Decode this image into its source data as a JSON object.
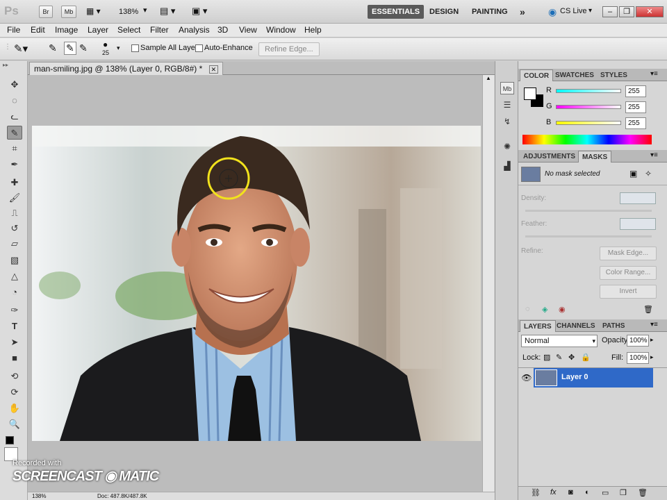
{
  "app": {
    "logo": "Ps",
    "bridge": "Br",
    "minibridge": "Mb",
    "zoom": "138%"
  },
  "workspaces": [
    "ESSENTIALS",
    "DESIGN",
    "PAINTING"
  ],
  "more_workspaces": "»",
  "cs_live": "CS Live",
  "window_controls": {
    "minimize": "–",
    "restore": "❐",
    "close": "✕"
  },
  "menu": [
    "File",
    "Edit",
    "Image",
    "Layer",
    "Select",
    "Filter",
    "Analysis",
    "3D",
    "View",
    "Window",
    "Help"
  ],
  "options": {
    "brush_size": "25",
    "sample_all_layers": "Sample All Layers",
    "auto_enhance": "Auto-Enhance",
    "refine_edge": "Refine Edge..."
  },
  "document": {
    "tab_title": "man-smiling.jpg @ 138% (Layer 0, RGB/8#) *",
    "close": "✕"
  },
  "status": {
    "zoom": "138%",
    "doc": "Doc: 487.8K/487.8K"
  },
  "color_panel": {
    "tabs": [
      "COLOR",
      "SWATCHES",
      "STYLES"
    ],
    "channels": [
      {
        "label": "R",
        "value": "255",
        "color": "#00ffff"
      },
      {
        "label": "G",
        "value": "255",
        "color": "#ff00ff"
      },
      {
        "label": "B",
        "value": "255",
        "color": "#ffff00"
      }
    ]
  },
  "masks_panel": {
    "tabs": [
      "ADJUSTMENTS",
      "MASKS"
    ],
    "no_mask": "No mask selected",
    "density": "Density:",
    "feather": "Feather:",
    "refine": "Refine:",
    "buttons": [
      "Mask Edge...",
      "Color Range...",
      "Invert"
    ]
  },
  "layers_panel": {
    "tabs": [
      "LAYERS",
      "CHANNELS",
      "PATHS"
    ],
    "blend_mode": "Normal",
    "opacity_label": "Opacity:",
    "opacity": "100%",
    "lock_label": "Lock:",
    "fill_label": "Fill:",
    "fill": "100%",
    "layers": [
      {
        "name": "Layer 0"
      }
    ]
  },
  "watermark": {
    "line1": "Recorded with",
    "line2": "SCREENCAST",
    "line3": "MATIC"
  }
}
